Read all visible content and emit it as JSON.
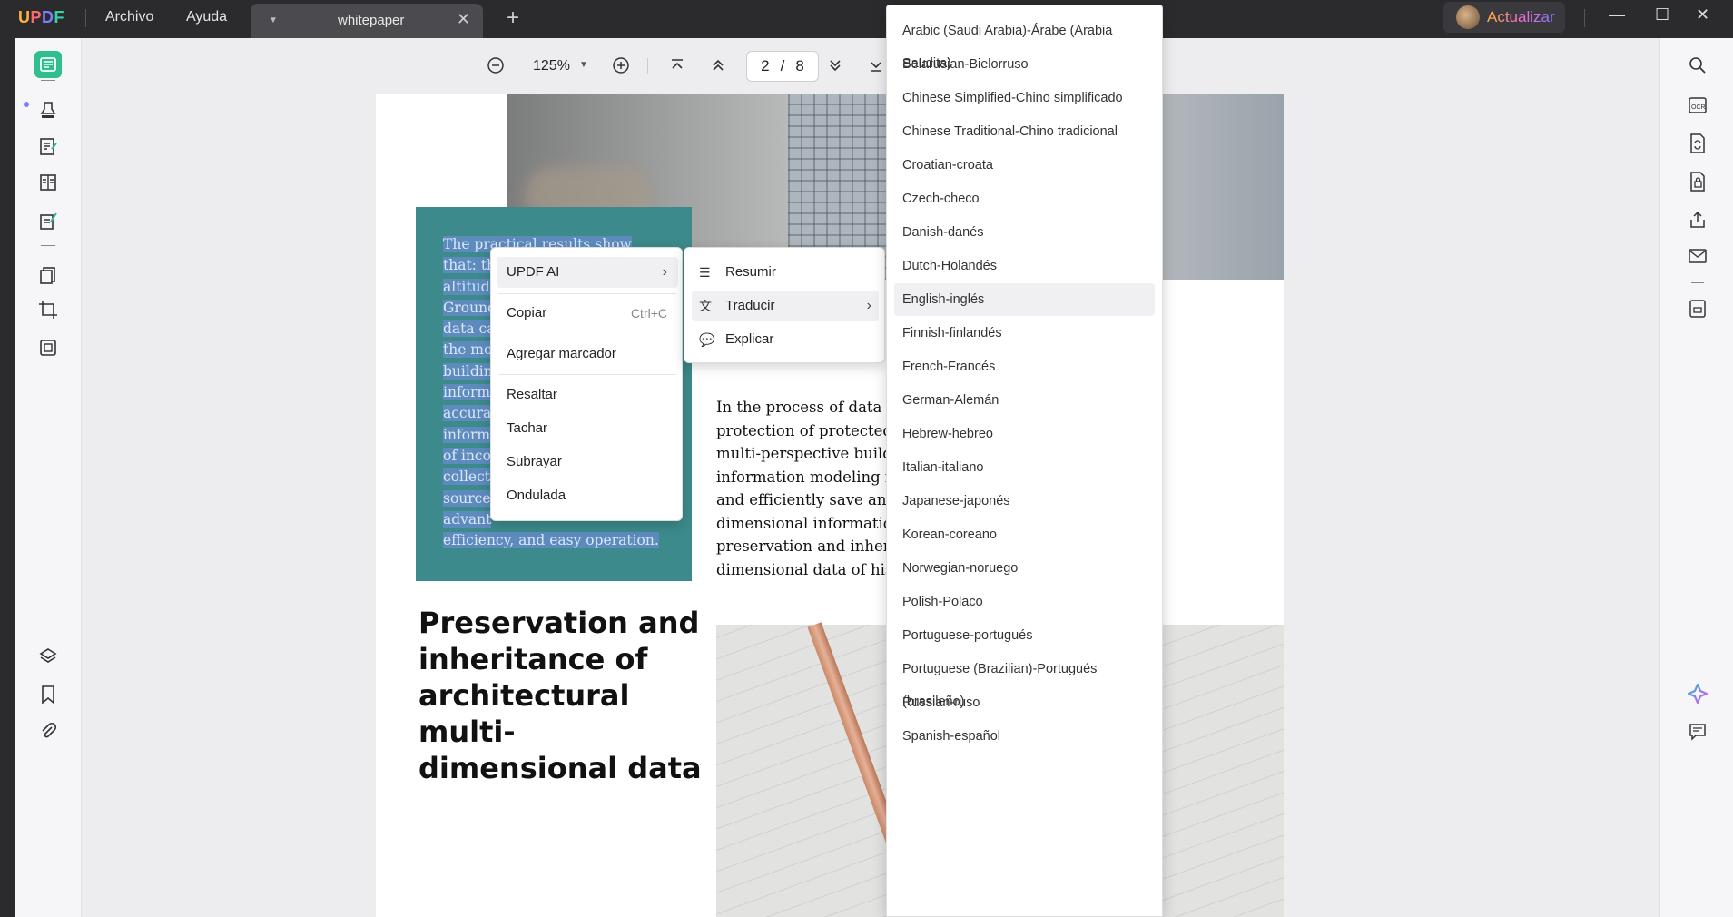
{
  "app": {
    "logo": "UPDF",
    "menu": [
      "Archivo",
      "Ayuda"
    ],
    "tab_title": "whitepaper",
    "upgrade_label": "Actualizar"
  },
  "toolbar": {
    "zoom": "125%",
    "current_page": "2",
    "page_sep": "/",
    "total_pages": "8"
  },
  "document": {
    "highlighted_lines": [
      "The practical results show",
      "that: the method is fast and",
      "altitude",
      "Ground",
      "data ca",
      "the mo",
      "buildin",
      "inform",
      "accura",
      "inform",
      "of inco",
      "collecte",
      "source,",
      "advant",
      "efficiency, and easy operation."
    ],
    "body_lines": [
      "In the process of data colle",
      "protection of protected bu",
      "multi-perspective buildin",
      "information modeling me",
      "and efficiently save and re",
      "dimensional information,",
      "preservation and inherita",
      "dimensional data of histo"
    ],
    "heading_lines": [
      "Preservation and",
      "inheritance of",
      "architectural multi-",
      "dimensional data"
    ]
  },
  "context_menu": {
    "ai_label": "UPDF AI",
    "copy_label": "Copiar",
    "copy_shortcut": "Ctrl+C",
    "bookmark_label": "Agregar marcador",
    "highlight_label": "Resaltar",
    "strike_label": "Tachar",
    "underline_label": "Subrayar",
    "squiggly_label": "Ondulada"
  },
  "ai_submenu": {
    "summarize": "Resumir",
    "translate": "Traducir",
    "explain": "Explicar"
  },
  "languages": [
    "Arabic (Saudi Arabia)-Árabe (Arabia Saudita)",
    "Belarusian-Bielorruso",
    "Chinese Simplified-Chino simplificado",
    "Chinese Traditional-Chino tradicional",
    "Croatian-croata",
    "Czech-checo",
    "Danish-danés",
    "Dutch-Holandés",
    "English-inglés",
    "Finnish-finlandés",
    "French-Francés",
    "German-Alemán",
    "Hebrew-hebreo",
    "Italian-italiano",
    "Japanese-japonés",
    "Korean-coreano",
    "Norwegian-noruego",
    "Polish-Polaco",
    "Portuguese-portugués",
    "Portuguese (Brazilian)-Portugués (brasileño)",
    "Russian-ruso",
    "Spanish-español"
  ],
  "selected_language": "English-inglés",
  "colors": {
    "accent_green": "#2fbf8f",
    "teal_block": "#3c8a8b",
    "selection": "#7c8ce6"
  }
}
